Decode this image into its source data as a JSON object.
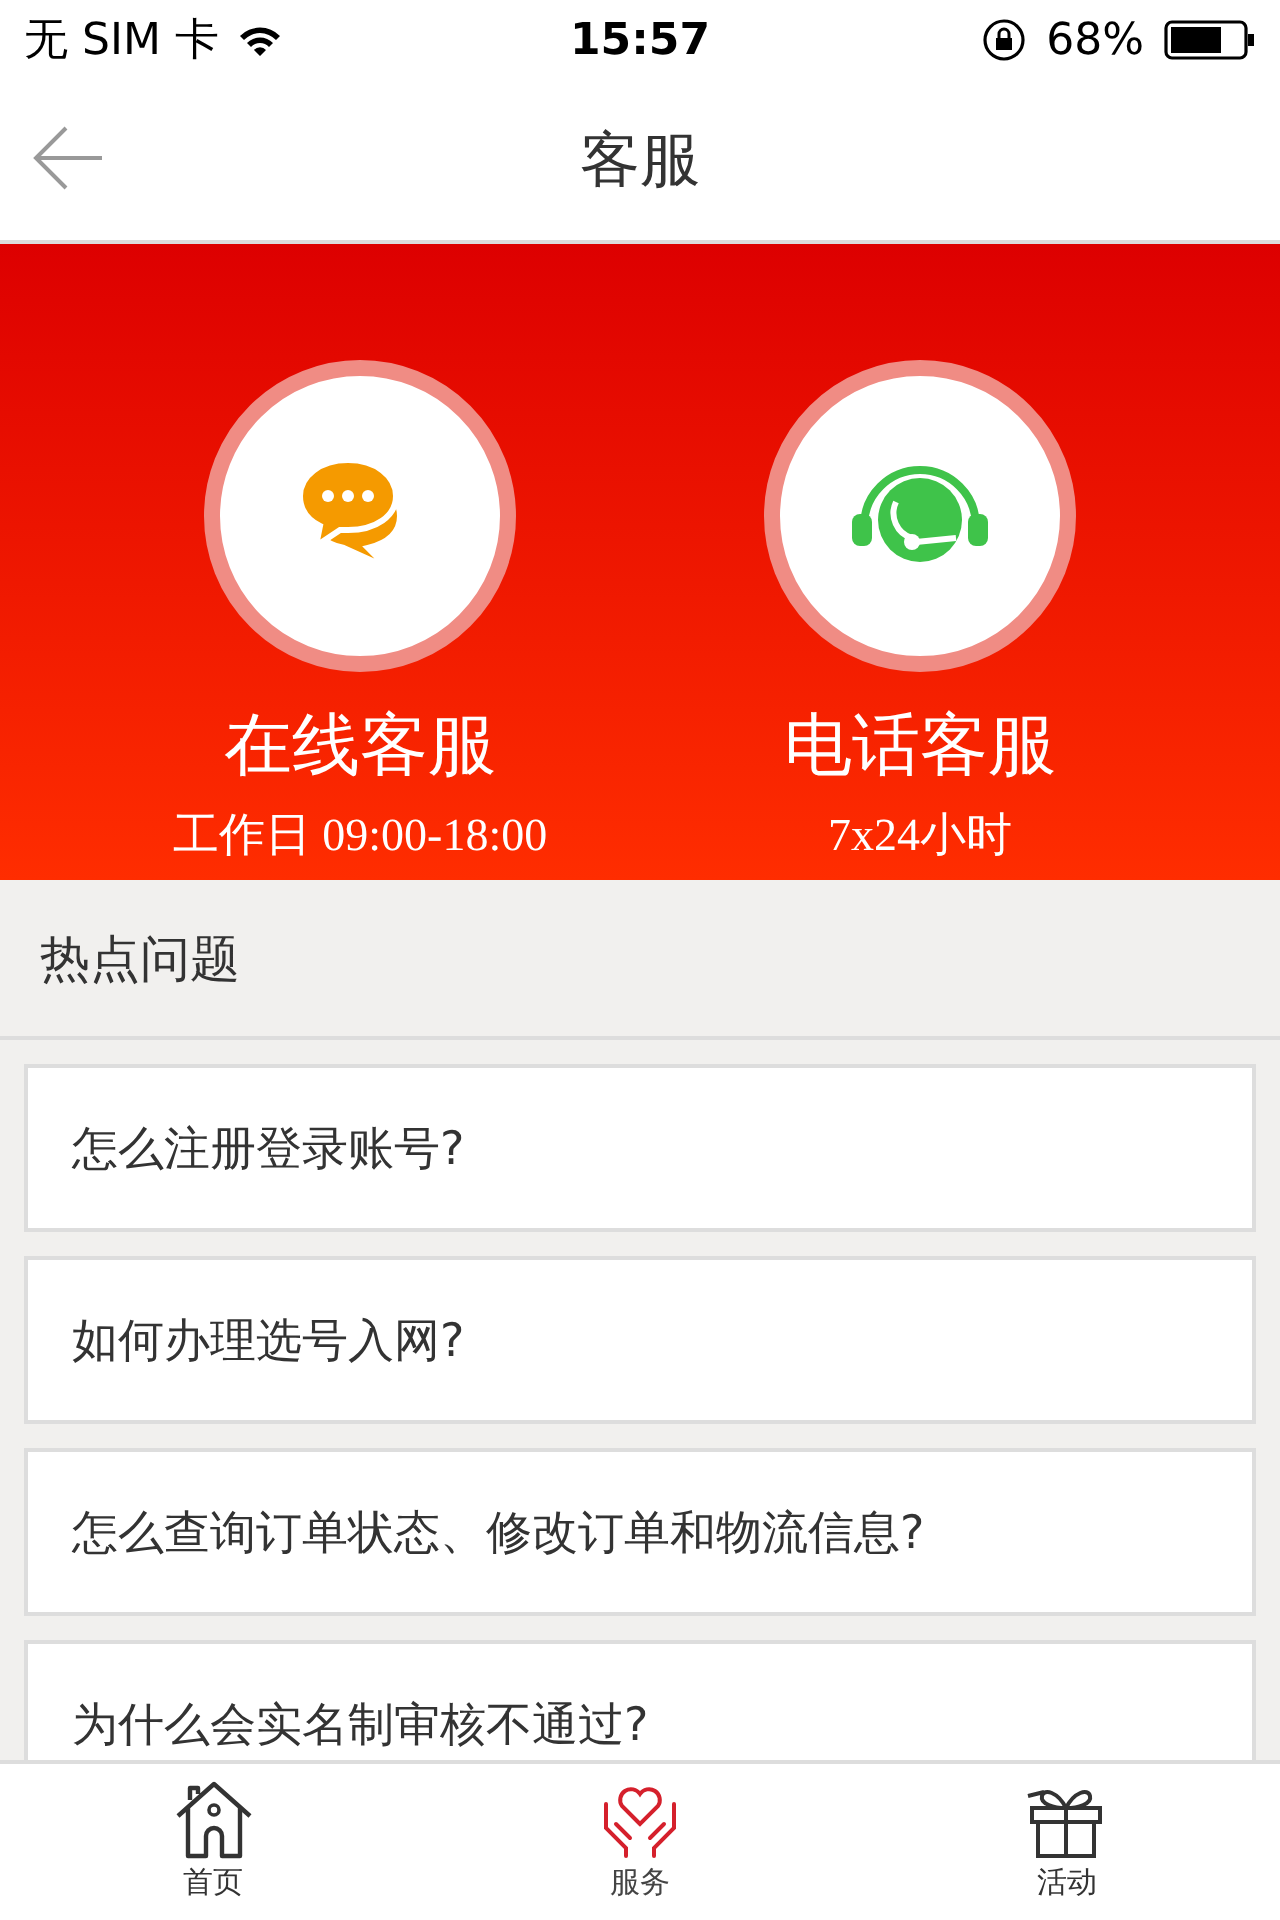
{
  "status_bar": {
    "carrier": "无 SIM 卡",
    "time": "15:57",
    "battery": "68%"
  },
  "nav": {
    "title": "客服"
  },
  "services": [
    {
      "kind": "chat",
      "title": "在线客服",
      "hours": "工作日 09:00-18:00"
    },
    {
      "kind": "phone",
      "title": "电话客服",
      "hours": "7x24小时"
    }
  ],
  "faq": {
    "heading": "热点问题",
    "items": [
      "怎么注册登录账号?",
      "如何办理选号入网?",
      "怎么查询订单状态、修改订单和物流信息?",
      "为什么会实名制审核不通过?"
    ]
  },
  "tabs": [
    {
      "kind": "home",
      "label": "首页",
      "selected": false
    },
    {
      "kind": "service",
      "label": "服务",
      "selected": true
    },
    {
      "kind": "gift",
      "label": "活动",
      "selected": false
    }
  ]
}
